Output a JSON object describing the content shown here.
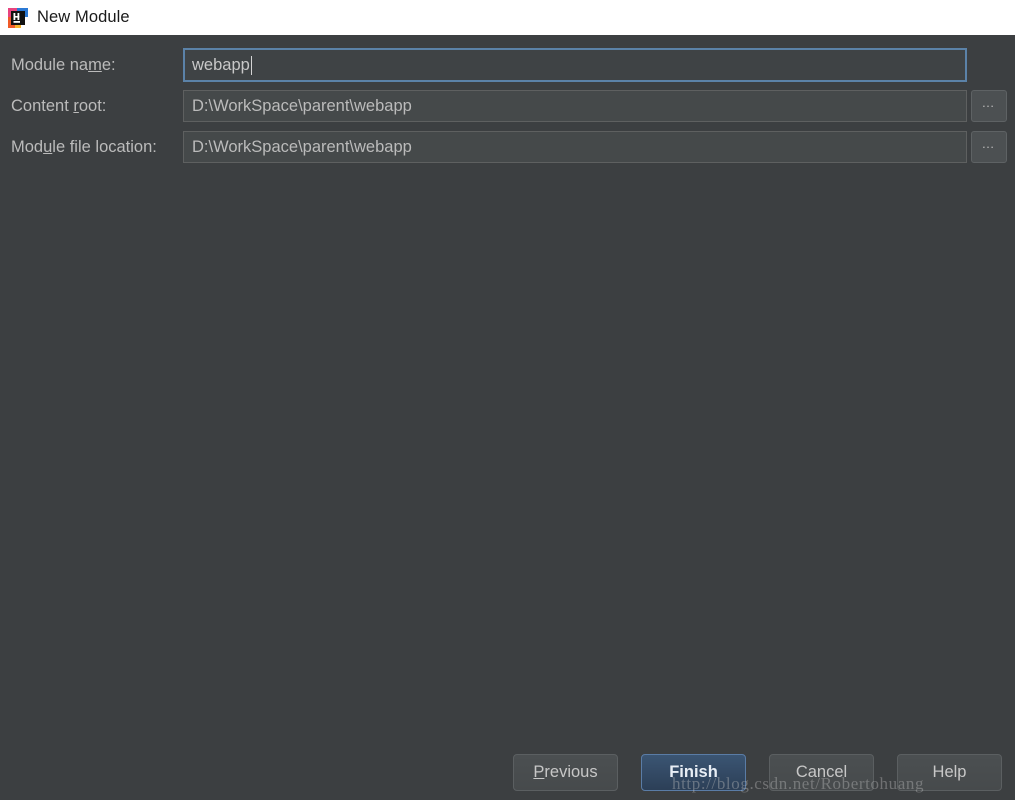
{
  "window": {
    "title": "New Module",
    "app_icon": "intellij-idea-icon",
    "close_icon": "close-icon",
    "background_color": "#3c3f41",
    "titlebar_color": "#ffffff",
    "accent_color": "#5b82a8"
  },
  "form": {
    "rows": [
      {
        "label_before": "Module na",
        "label_mnemonic": "m",
        "label_after": "e:",
        "value": "webapp",
        "focused": true,
        "has_browse": false,
        "name": "module-name"
      },
      {
        "label_before": "Content ",
        "label_mnemonic": "r",
        "label_after": "oot:",
        "value": "D:\\WorkSpace\\parent\\webapp",
        "focused": false,
        "has_browse": true,
        "browse_label": "…",
        "name": "content-root"
      },
      {
        "label_before": "Mod",
        "label_mnemonic": "u",
        "label_after": "le file location:",
        "value": "D:\\WorkSpace\\parent\\webapp",
        "focused": false,
        "has_browse": true,
        "browse_label": "…",
        "name": "module-file-location"
      }
    ]
  },
  "buttons": [
    {
      "name": "previous-button",
      "before": "",
      "mnemonic": "P",
      "after": "revious",
      "default": false
    },
    {
      "name": "finish-button",
      "before": "",
      "mnemonic": "F",
      "after": "inish",
      "default": true
    },
    {
      "name": "cancel-button",
      "before": "Cancel",
      "mnemonic": "",
      "after": "",
      "default": false
    },
    {
      "name": "help-button",
      "before": "Help",
      "mnemonic": "",
      "after": "",
      "default": false
    }
  ],
  "watermark": {
    "text": "http://blog.csdn.net/Robertohuang"
  }
}
